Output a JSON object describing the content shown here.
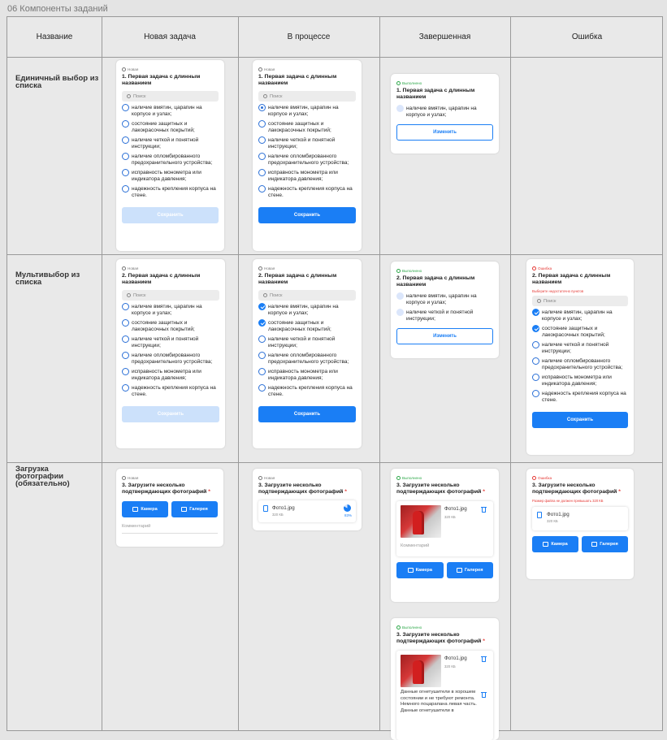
{
  "page_title": "06 Компоненты заданий",
  "columns": [
    "Название",
    "Новая задача",
    "В процессе",
    "Завершенная",
    "Ошибка"
  ],
  "rows": [
    "Единичный выбор из списка",
    "Мультивыбор из списка",
    "Загрузка фотографии (обязательно)"
  ],
  "status": {
    "new": "Новая",
    "done": "Выполнено",
    "error": "Ошибка"
  },
  "q1": "1. Первая задача с длинным названием",
  "q2": "2. Первая задача с длинным названием",
  "q3": "3. Загрузите несколько подтверждающих фотографий",
  "req": "*",
  "search": "Поиск",
  "options": [
    "наличие вмятин, царапин на корпусе и узлах;",
    "состояние защитных и лакокрасочных покрытий;",
    "наличие четкой и понятной инструкции;",
    "наличие опломбированного предохранительного устройства;",
    "исправность монометра или индикатора давления;",
    "надежность крепления корпуса на стене."
  ],
  "btn_save": "Сохранить",
  "btn_change": "Изменить",
  "btn_camera": "Камера",
  "btn_gallery": "Галерея",
  "comment": "Комментарий",
  "err_multi": "Выберите недостаточно пунктов",
  "err_photo": "Размер файла не должен превышать 320 КБ",
  "file": {
    "name": "Фото1.jpg",
    "size": "320 КБ",
    "progress": "83%"
  },
  "desc": "Данные огнетушители в хорошем состоянии и не требуют ремонта. Немного поцарапана левая часть. Данные огнетушители в"
}
